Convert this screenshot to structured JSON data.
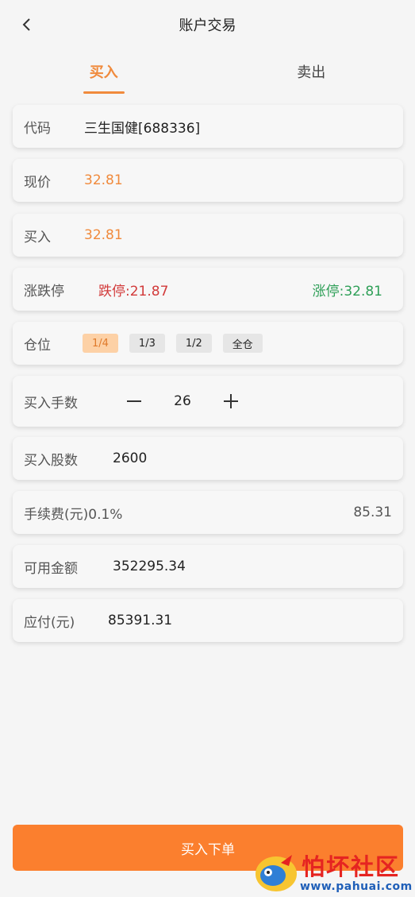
{
  "header": {
    "title": "账户交易",
    "back_icon": "chevron-left-icon"
  },
  "tabs": [
    {
      "label": "买入",
      "active": true
    },
    {
      "label": "卖出",
      "active": false
    }
  ],
  "form": {
    "code": {
      "label": "代码",
      "value": "三生国健[688336]"
    },
    "price": {
      "label": "现价",
      "value": "32.81"
    },
    "buy": {
      "label": "买入",
      "value": "32.81"
    },
    "limits": {
      "label": "涨跌停",
      "down": "跌停:21.87",
      "up": "涨停:32.81"
    },
    "position": {
      "label": "仓位",
      "options": [
        "1/4",
        "1/3",
        "1/2",
        "全仓"
      ],
      "selected": "1/4"
    },
    "lots": {
      "label": "买入手数",
      "value": "26"
    },
    "shares": {
      "label": "买入股数",
      "value": "2600"
    },
    "fee": {
      "label": "手续费(元)0.1%",
      "value": "85.31"
    },
    "available": {
      "label": "可用金额",
      "value": "352295.34"
    },
    "payable": {
      "label": "应付(元)",
      "value": "85391.31"
    }
  },
  "submit_label": "买入下单",
  "watermark": {
    "text": "怕坏社区",
    "url": "www.pahuai.com"
  },
  "colors": {
    "accent": "#f08a3c",
    "button": "#fb7f2e",
    "down": "#d23a3a",
    "up": "#2e9f57"
  }
}
